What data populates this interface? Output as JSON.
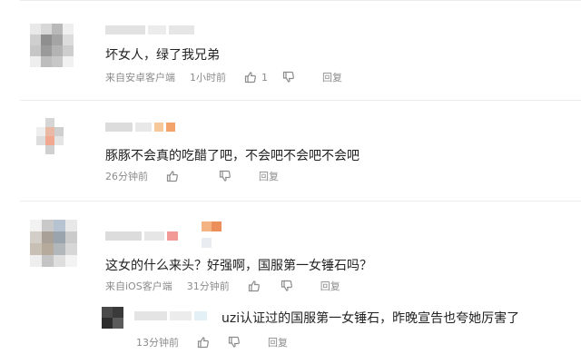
{
  "comments": [
    {
      "text": "坏女人，绿了我兄弟",
      "source": "来自安卓客户端",
      "time": "1小时前",
      "likes": "1",
      "reply": "回复"
    },
    {
      "text": "豚豚不会真的吃醋了吧，不会吧不会吧不会吧",
      "time": "26分钟前",
      "reply": "回复"
    },
    {
      "text": "这女的什么来头？好强啊，国服第一女锤石吗？",
      "source": "来自iOS客户端",
      "time": "31分钟前",
      "reply": "回复"
    }
  ],
  "reply": {
    "text": "uzi认证过的国服第一女锤石，昨晚宣告也夸她厉害了",
    "time": "13分钟前",
    "reply": "回复"
  },
  "colors": {
    "text": "#222222",
    "meta": "#8c8c8c",
    "divider": "#ececec"
  },
  "icons": [
    "thumb-up-icon",
    "thumb-down-icon"
  ]
}
